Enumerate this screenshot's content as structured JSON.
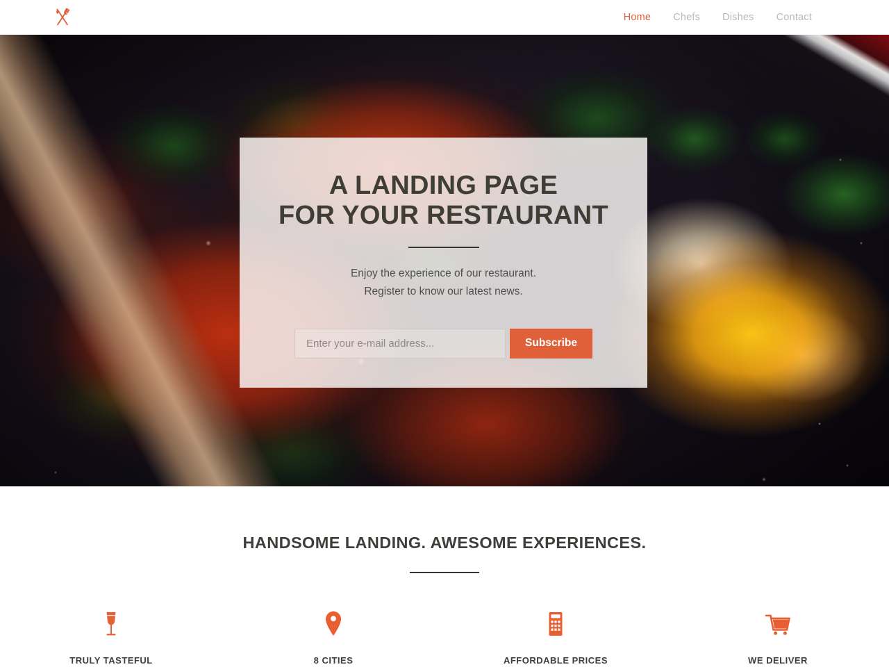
{
  "theme": {
    "accent": "#e0603a",
    "heading_color": "#3e3e3a",
    "nav_inactive": "#b9b9b9"
  },
  "navbar": {
    "logo_icon": "fork-knife-crossed-icon",
    "links": [
      {
        "label": "Home",
        "active": true
      },
      {
        "label": "Chefs",
        "active": false
      },
      {
        "label": "Dishes",
        "active": false
      },
      {
        "label": "Contact",
        "active": false
      }
    ]
  },
  "hero": {
    "background_image": "skillet-food-photo",
    "title_line1": "A LANDING PAGE",
    "title_line2": "FOR YOUR RESTAURANT",
    "subtitle_line1": "Enjoy the experience of our restaurant.",
    "subtitle_line2": "Register to know our latest news.",
    "form": {
      "email_value": "",
      "email_placeholder": "Enter your e-mail address...",
      "submit_label": "Subscribe"
    }
  },
  "features_section": {
    "title": "HANDSOME LANDING. AWESOME EXPERIENCES.",
    "items": [
      {
        "label": "TRULY TASTEFUL",
        "icon": "wine-glass-icon"
      },
      {
        "label": "8 CITIES",
        "icon": "map-pin-icon"
      },
      {
        "label": "AFFORDABLE PRICES",
        "icon": "calculator-icon"
      },
      {
        "label": "WE DELIVER",
        "icon": "shopping-cart-icon"
      }
    ]
  }
}
